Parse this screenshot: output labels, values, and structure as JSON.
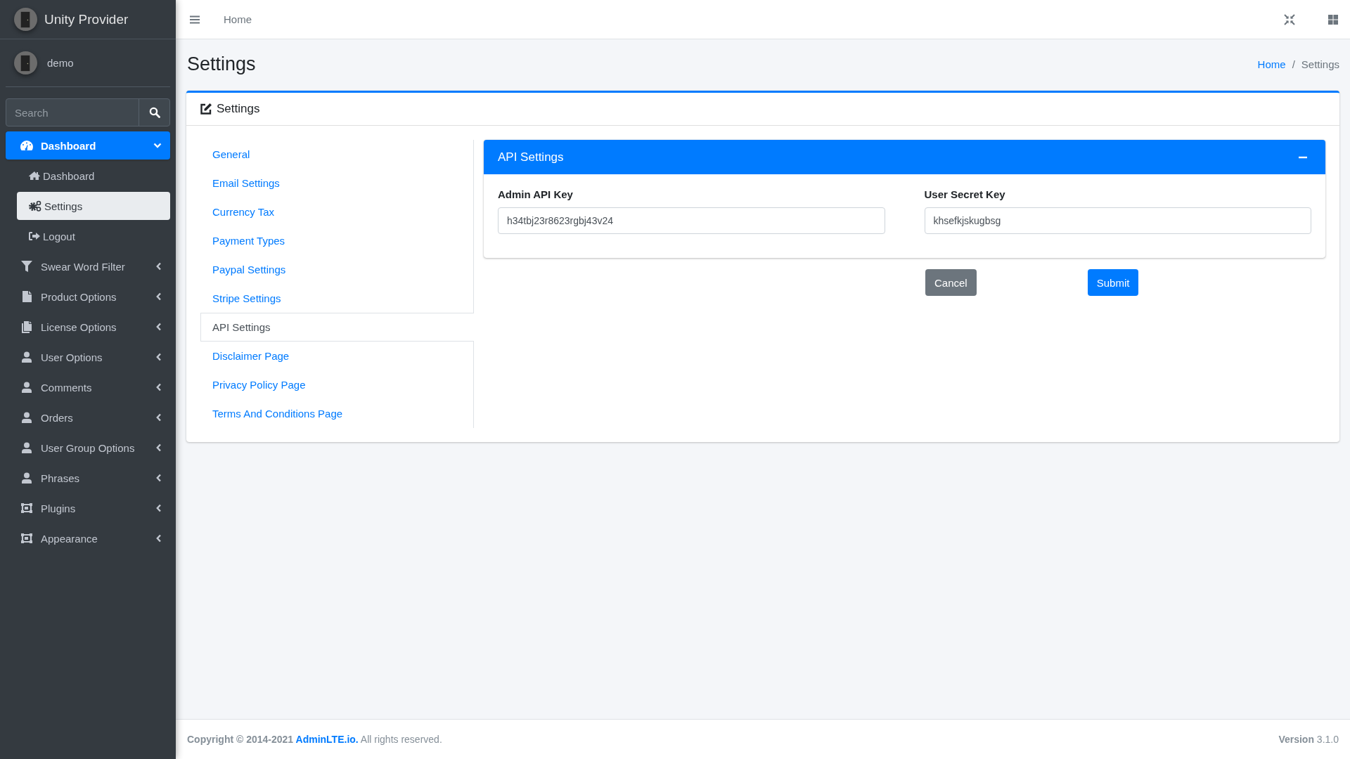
{
  "brand": {
    "name": "Unity Provider"
  },
  "user": {
    "name": "demo"
  },
  "sidebar_search": {
    "placeholder": "Search"
  },
  "nav": [
    {
      "label": "Dashboard",
      "kind": "gauge",
      "expanded": true,
      "selected": true,
      "children": [
        {
          "label": "Dashboard",
          "kind": "home",
          "selected": false
        },
        {
          "label": "Settings",
          "kind": "gears",
          "selected": true
        },
        {
          "label": "Logout",
          "kind": "signout",
          "selected": false
        }
      ]
    },
    {
      "label": "Swear Word Filter",
      "kind": "filter",
      "expanded": false,
      "selected": false
    },
    {
      "label": "Product Options",
      "kind": "file",
      "expanded": false,
      "selected": false
    },
    {
      "label": "License Options",
      "kind": "files",
      "expanded": false,
      "selected": false
    },
    {
      "label": "User Options",
      "kind": "user",
      "expanded": false,
      "selected": false
    },
    {
      "label": "Comments",
      "kind": "user",
      "expanded": false,
      "selected": false
    },
    {
      "label": "Orders",
      "kind": "user",
      "expanded": false,
      "selected": false
    },
    {
      "label": "User Group Options",
      "kind": "user",
      "expanded": false,
      "selected": false
    },
    {
      "label": "Phrases",
      "kind": "user",
      "expanded": false,
      "selected": false
    },
    {
      "label": "Plugins",
      "kind": "frame",
      "expanded": false,
      "selected": false
    },
    {
      "label": "Appearance",
      "kind": "frame",
      "expanded": false,
      "selected": false
    }
  ],
  "topbar": {
    "links": [
      "Home"
    ]
  },
  "page": {
    "title": "Settings",
    "breadcrumb": [
      {
        "label": "Home"
      },
      {
        "label": "Settings"
      }
    ],
    "separator": "/"
  },
  "card": {
    "title": "Settings",
    "tabs": [
      {
        "label": "General",
        "selected": false
      },
      {
        "label": "Email Settings",
        "selected": false
      },
      {
        "label": "Currency Tax",
        "selected": false
      },
      {
        "label": "Payment Types",
        "selected": false
      },
      {
        "label": "Paypal Settings",
        "selected": false
      },
      {
        "label": "Stripe Settings",
        "selected": false
      },
      {
        "label": "API Settings",
        "selected": true
      },
      {
        "label": "Disclaimer Page",
        "selected": false
      },
      {
        "label": "Privacy Policy Page",
        "selected": false
      },
      {
        "label": "Terms And Conditions Page",
        "selected": false
      }
    ],
    "panel": {
      "title": "API Settings",
      "expanded": true,
      "fields": [
        {
          "label": "Admin API Key",
          "value": "h34tbj23r8623rgbj43v24"
        },
        {
          "label": "User Secret Key",
          "value": "khsefkjskugbsg"
        }
      ]
    },
    "buttons": [
      {
        "label": "Cancel",
        "kind": "secondary"
      },
      {
        "label": "Submit",
        "kind": "primary"
      }
    ]
  },
  "footer": {
    "copyright": "Copyright © 2014-2021",
    "link": "AdminLTE.io.",
    "rest": "All rights reserved.",
    "version": "**Version** 3.1.0"
  }
}
